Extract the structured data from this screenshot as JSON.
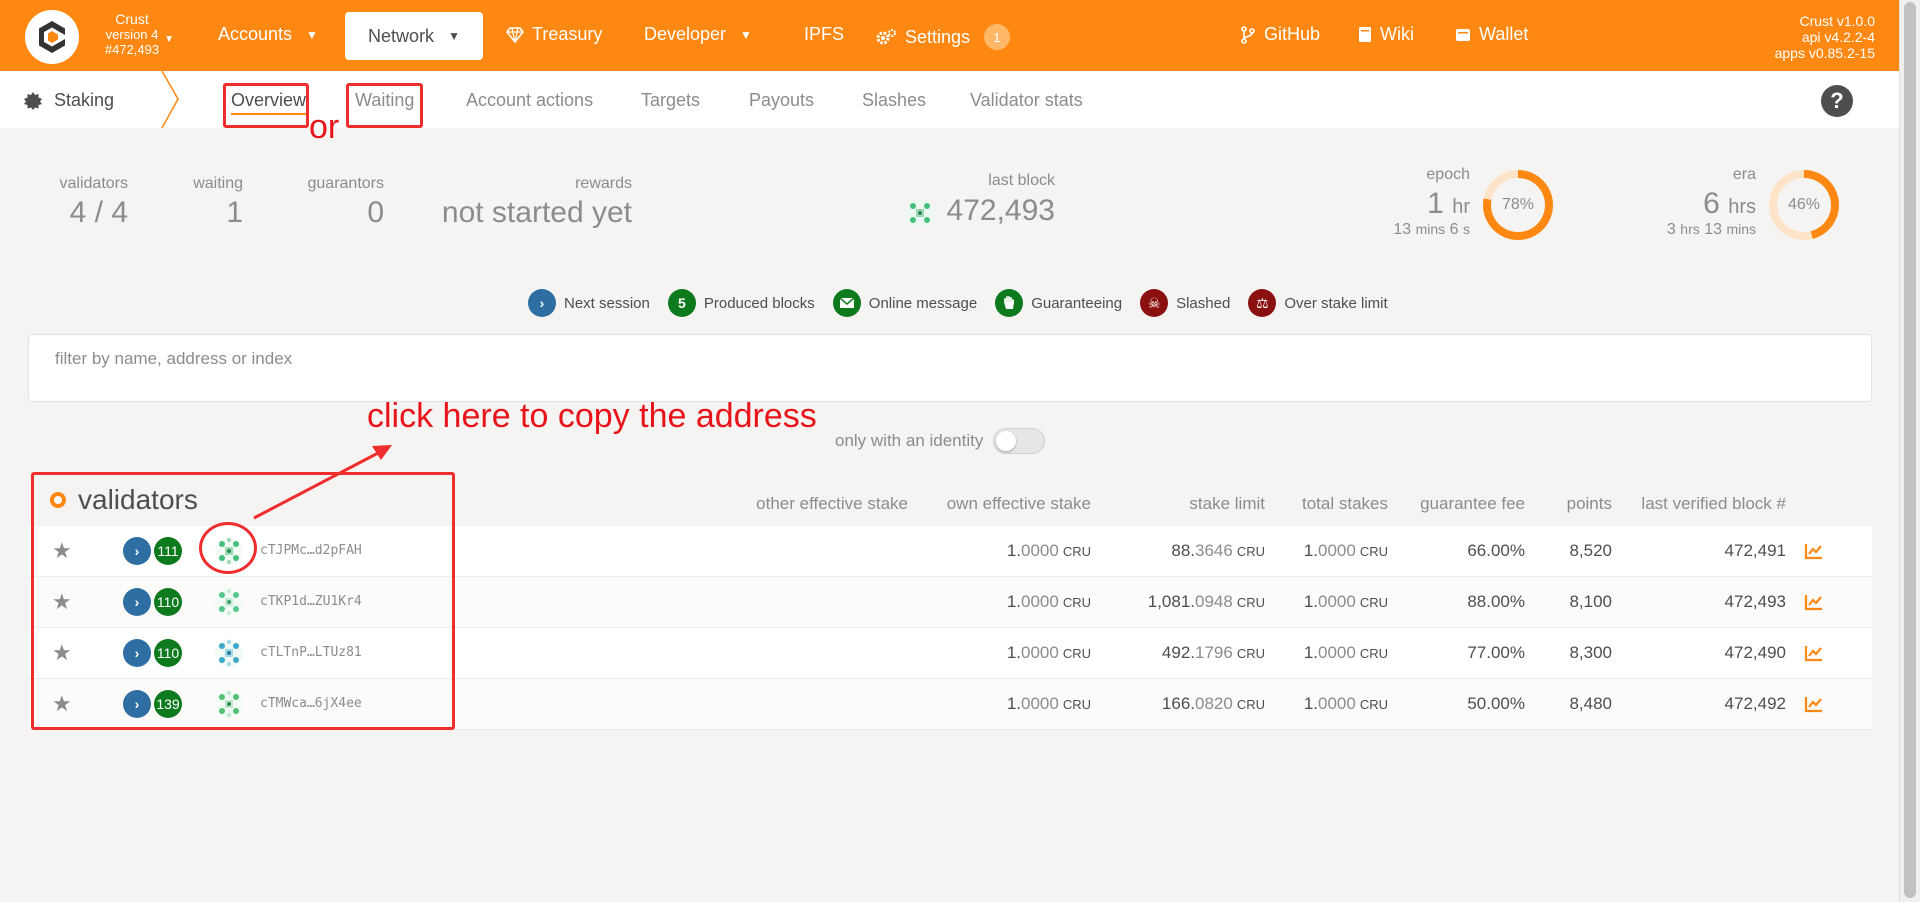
{
  "topbar": {
    "chain_name": "Crust",
    "chain_version": "version 4",
    "chain_block": "#472,493",
    "nav": {
      "accounts": "Accounts",
      "network": "Network",
      "treasury": "Treasury",
      "developer": "Developer",
      "ipfs": "IPFS",
      "settings": "Settings",
      "settings_badge": "1",
      "github": "GitHub",
      "wiki": "Wiki",
      "wallet": "Wallet"
    },
    "versions": [
      "Crust v1.0.0",
      "api v4.2.2-4",
      "apps v0.85.2-15"
    ]
  },
  "subbar": {
    "section": "Staking",
    "tabs": [
      "Overview",
      "Waiting",
      "Account actions",
      "Targets",
      "Payouts",
      "Slashes",
      "Validator stats"
    ]
  },
  "summary": {
    "validators_label": "validators",
    "validators_value": "4 / 4",
    "waiting_label": "waiting",
    "waiting_value": "1",
    "guarantors_label": "guarantors",
    "guarantors_value": "0",
    "rewards_label": "rewards",
    "rewards_value": "not started yet",
    "last_block_label": "last block",
    "last_block_value": "472,493",
    "epoch_label": "epoch",
    "epoch_num": "1",
    "epoch_unit": "hr",
    "epoch_sub_a": "13",
    "epoch_sub_a_unit": "mins",
    "epoch_sub_b": "6",
    "epoch_sub_b_unit": "s",
    "epoch_percent": 78,
    "epoch_percent_text": "78%",
    "era_label": "era",
    "era_num": "6",
    "era_unit": "hrs",
    "era_sub_a": "3",
    "era_sub_a_unit": "hrs",
    "era_sub_b": "13",
    "era_sub_b_unit": "mins",
    "era_percent": 46,
    "era_percent_text": "46%"
  },
  "legend": {
    "next_session": "Next session",
    "produced_blocks": "Produced blocks",
    "produced_blocks_badge": "5",
    "online_message": "Online message",
    "guaranteeing": "Guaranteeing",
    "slashed": "Slashed",
    "over_stake_limit": "Over stake limit"
  },
  "filter": {
    "placeholder": "filter by name, address or index"
  },
  "identity_toggle": "only with an identity",
  "table": {
    "title": "validators",
    "headers": {
      "other_stake": "other effective stake",
      "own_stake": "own effective stake",
      "stake_limit": "stake limit",
      "total_stakes": "total stakes",
      "guarantee_fee": "guarantee fee",
      "points": "points",
      "last_block": "last verified block #"
    },
    "unit": "CRU",
    "rows": [
      {
        "produced": "111",
        "address": "cTJPMc…d2pFAH",
        "own_int": "1.",
        "own_dec": "0000",
        "limit_int": "88.",
        "limit_dec": "3646",
        "total_int": "1.",
        "total_dec": "0000",
        "fee": "66.00%",
        "points": "8,520",
        "block": "472,491"
      },
      {
        "produced": "110",
        "address": "cTKP1d…ZU1Kr4",
        "own_int": "1.",
        "own_dec": "0000",
        "limit_int": "1,081.",
        "limit_dec": "0948",
        "total_int": "1.",
        "total_dec": "0000",
        "fee": "88.00%",
        "points": "8,100",
        "block": "472,493"
      },
      {
        "produced": "110",
        "address": "cTLTnP…LTUz81",
        "own_int": "1.",
        "own_dec": "0000",
        "limit_int": "492.",
        "limit_dec": "1796",
        "total_int": "1.",
        "total_dec": "0000",
        "fee": "77.00%",
        "points": "8,300",
        "block": "472,490"
      },
      {
        "produced": "139",
        "address": "cTMWca…6jX4ee",
        "own_int": "1.",
        "own_dec": "0000",
        "limit_int": "166.",
        "limit_dec": "0820",
        "total_int": "1.",
        "total_dec": "0000",
        "fee": "50.00%",
        "points": "8,480",
        "block": "472,492"
      }
    ]
  },
  "annotations": {
    "or": "or",
    "copy_hint": "click here to copy the address"
  },
  "colors": {
    "brand": "#ff8812",
    "annotation": "#ef2d2d"
  }
}
